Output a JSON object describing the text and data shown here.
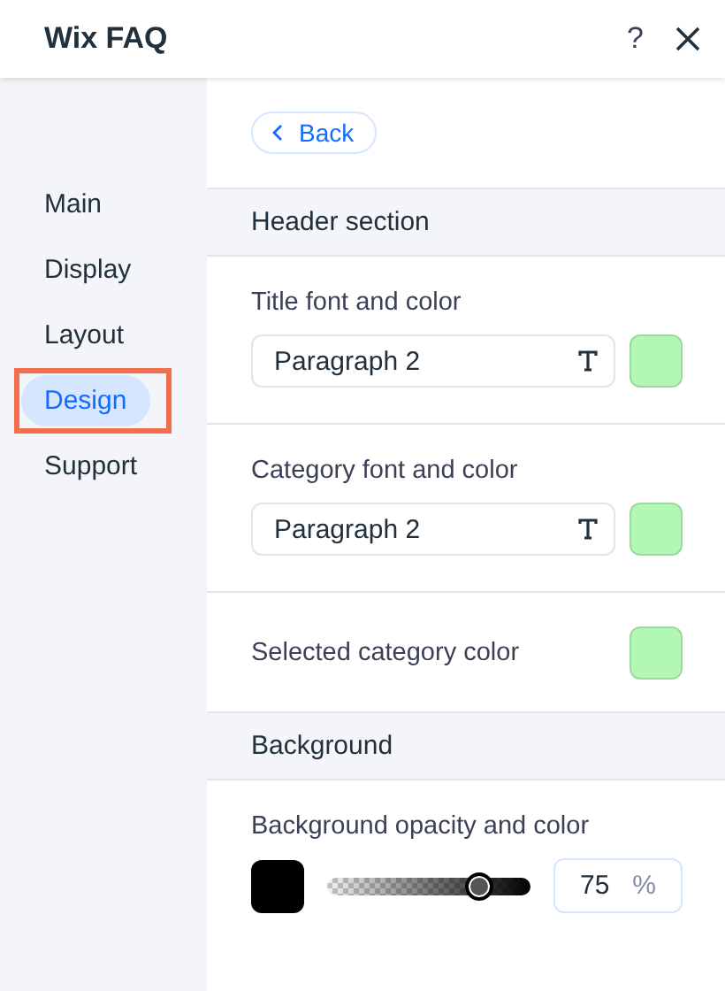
{
  "window": {
    "title": "Wix FAQ",
    "help": "?"
  },
  "sidebar": {
    "items": [
      {
        "label": "Main",
        "selected": false,
        "highlighted": false
      },
      {
        "label": "Display",
        "selected": false,
        "highlighted": false
      },
      {
        "label": "Layout",
        "selected": false,
        "highlighted": false
      },
      {
        "label": "Design",
        "selected": true,
        "highlighted": true
      },
      {
        "label": "Support",
        "selected": false,
        "highlighted": false
      }
    ]
  },
  "back_button": {
    "label": "Back"
  },
  "sections": [
    {
      "kind": "header",
      "title": "Header section"
    },
    {
      "kind": "font_color",
      "label": "Title font and color",
      "font": "Paragraph 2",
      "color": "#b3f7b5"
    },
    {
      "kind": "font_color",
      "label": "Category font and color",
      "font": "Paragraph 2",
      "color": "#b3f7b5"
    },
    {
      "kind": "color",
      "label": "Selected category color",
      "color": "#b3f7b5"
    },
    {
      "kind": "header",
      "title": "Background"
    },
    {
      "kind": "opacity_color",
      "label": "Background opacity and color",
      "color": "#000000",
      "level": 0.75,
      "value": "75",
      "unit": "%"
    }
  ]
}
